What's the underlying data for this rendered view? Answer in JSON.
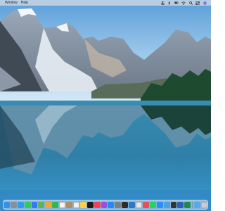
{
  "menubar": {
    "items": [
      {
        "label": "Window"
      },
      {
        "label": "Help"
      }
    ],
    "status_icons": [
      "scissors-icon",
      "bluetooth-icon",
      "battery-icon",
      "wifi-icon",
      "search-icon",
      "control-center-icon",
      "siri-icon"
    ]
  },
  "dock": {
    "apps": [
      {
        "name": "finder-icon",
        "color": "#3a8fe8"
      },
      {
        "name": "launchpad-icon",
        "color": "#8a8f9a"
      },
      {
        "name": "safari-icon",
        "color": "#2f9bf0"
      },
      {
        "name": "messages-icon",
        "color": "#34c759"
      },
      {
        "name": "mail-icon",
        "color": "#3478f6"
      },
      {
        "name": "maps-icon",
        "color": "#5fb35a"
      },
      {
        "name": "photos-icon",
        "color": "#f2a33a"
      },
      {
        "name": "facetime-icon",
        "color": "#30b94d"
      },
      {
        "name": "calendar-icon",
        "color": "#f4f4f4"
      },
      {
        "name": "contacts-icon",
        "color": "#b08d6a"
      },
      {
        "name": "reminders-icon",
        "color": "#f2f2f2"
      },
      {
        "name": "notes-icon",
        "color": "#f6d34a"
      },
      {
        "name": "tv-icon",
        "color": "#1c1c1e"
      },
      {
        "name": "music-icon",
        "color": "#fa3c5a"
      },
      {
        "name": "podcasts-icon",
        "color": "#9b4fd8"
      },
      {
        "name": "app-store-icon",
        "color": "#1f8df5"
      },
      {
        "name": "system-preferences-icon",
        "color": "#7d7f86"
      },
      {
        "name": "terminal-icon",
        "color": "#2b2b2b"
      },
      {
        "name": "vscode-icon",
        "color": "#2a7ac8"
      },
      {
        "name": "chrome-icon",
        "color": "#e8e8e8"
      },
      {
        "name": "slack-icon",
        "color": "#e94e5a"
      },
      {
        "name": "spotify-icon",
        "color": "#1ed760"
      },
      {
        "name": "zoom-icon",
        "color": "#2d8cff"
      },
      {
        "name": "preview-icon",
        "color": "#4aa3df"
      },
      {
        "name": "activity-monitor-icon",
        "color": "#333"
      },
      {
        "name": "word-icon",
        "color": "#2b5fb8"
      },
      {
        "name": "excel-icon",
        "color": "#1f8a4c"
      }
    ],
    "trailing": [
      {
        "name": "downloads-folder-icon",
        "color": "#5aa8e6"
      },
      {
        "name": "trash-icon",
        "color": "#c9ccd2"
      }
    ]
  }
}
